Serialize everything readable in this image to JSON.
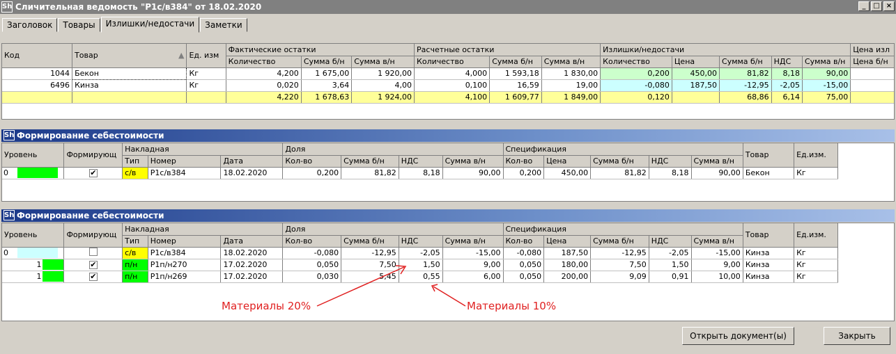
{
  "window": {
    "title": "Сличительная ведомость \"Р1с/в384\" от 18.02.2020",
    "icon": "Sh"
  },
  "tabs": [
    "Заголовок",
    "Товары",
    "Излишки/недостачи",
    "Заметки"
  ],
  "top_table": {
    "headers": {
      "code": "Код",
      "product": "Товар",
      "unit": "Ед. изм",
      "fact": "Фактические остатки",
      "calc": "Расчетные остатки",
      "surplus": "Излишки/недостачи",
      "price": "Цена изл"
    },
    "subheaders": {
      "qty": "Количество",
      "sum_wo": "Сумма б/н",
      "sum_w": "Сумма в/н",
      "price": "Цена",
      "vat": "НДС",
      "price_wo": "Цена б/н"
    },
    "rows": [
      {
        "code": "1044",
        "product": "Бекон",
        "unit": "Кг",
        "f_qty": "4,200",
        "f_wo": "1 675,00",
        "f_w": "1 920,00",
        "c_qty": "4,000",
        "c_wo": "1 593,18",
        "c_w": "1 830,00",
        "s_qty": "0,200",
        "s_price": "450,00",
        "s_wo": "81,82",
        "s_vat": "8,18",
        "s_w": "90,00"
      },
      {
        "code": "6496",
        "product": "Кинза",
        "unit": "Кг",
        "f_qty": "0,020",
        "f_wo": "3,64",
        "f_w": "4,00",
        "c_qty": "0,100",
        "c_wo": "16,59",
        "c_w": "19,00",
        "s_qty": "-0,080",
        "s_price": "187,50",
        "s_wo": "-12,95",
        "s_vat": "-2,05",
        "s_w": "-15,00"
      }
    ],
    "total": {
      "f_qty": "4,220",
      "f_wo": "1 678,63",
      "f_w": "1 924,00",
      "c_qty": "4,100",
      "c_wo": "1 609,77",
      "c_w": "1 849,00",
      "s_qty": "0,120",
      "s_wo": "68,86",
      "s_vat": "6,14",
      "s_w": "75,00"
    }
  },
  "cost_title": "Формирование себестоимости",
  "cost_headers": {
    "level": "Уровень",
    "form": "Формирующ",
    "invoice": "Накладная",
    "type": "Тип",
    "number": "Номер",
    "date": "Дата",
    "share": "Доля",
    "qty": "Кол-во",
    "sum_wo": "Сумма б/н",
    "vat": "НДС",
    "sum_w": "Сумма в/н",
    "spec": "Спецификация",
    "spec_qty": "Кол-во",
    "price": "Цена",
    "product": "Товар",
    "unit": "Ед.изм."
  },
  "cost1_rows": [
    {
      "level": "0",
      "checked": "✔",
      "type": "с/в",
      "number": "Р1с/в384",
      "date": "18.02.2020",
      "qty": "0,200",
      "sum_wo": "81,82",
      "vat": "8,18",
      "sum_w": "90,00",
      "s_qty": "0,200",
      "price": "450,00",
      "s_wo": "81,82",
      "s_vat": "8,18",
      "s_w": "90,00",
      "product": "Бекон",
      "unit": "Кг"
    }
  ],
  "cost2_rows": [
    {
      "level": "0",
      "checked": "",
      "type": "с/в",
      "number": "Р1с/в384",
      "date": "18.02.2020",
      "qty": "-0,080",
      "sum_wo": "-12,95",
      "vat": "-2,05",
      "sum_w": "-15,00",
      "s_qty": "-0,080",
      "price": "187,50",
      "s_wo": "-12,95",
      "s_vat": "-2,05",
      "s_w": "-15,00",
      "product": "Кинза",
      "unit": "Кг"
    },
    {
      "level": "1",
      "checked": "✔",
      "type": "п/н",
      "number": "Р1п/н270",
      "date": "17.02.2020",
      "qty": "0,050",
      "sum_wo": "7,50",
      "vat": "1,50",
      "sum_w": "9,00",
      "s_qty": "0,050",
      "price": "180,00",
      "s_wo": "7,50",
      "s_vat": "1,50",
      "s_w": "9,00",
      "product": "Кинза",
      "unit": "Кг"
    },
    {
      "level": "1",
      "checked": "✔",
      "type": "п/н",
      "number": "Р1п/н269",
      "date": "17.02.2020",
      "qty": "0,030",
      "sum_wo": "5,45",
      "vat": "0,55",
      "sum_w": "6,00",
      "s_qty": "0,050",
      "price": "200,00",
      "s_wo": "9,09",
      "s_vat": "0,91",
      "s_w": "10,00",
      "product": "Кинза",
      "unit": "Кг"
    }
  ],
  "annotations": {
    "left": "Материалы 20%",
    "right": "Материалы 10%"
  },
  "buttons": {
    "open": "Открыть документ(ы)",
    "close": "Закрыть"
  },
  "colors": {
    "total_row": "#ffff99",
    "type_sv": "#ffff00",
    "type_pn": "#00ff00",
    "annotation": "#e02020"
  }
}
